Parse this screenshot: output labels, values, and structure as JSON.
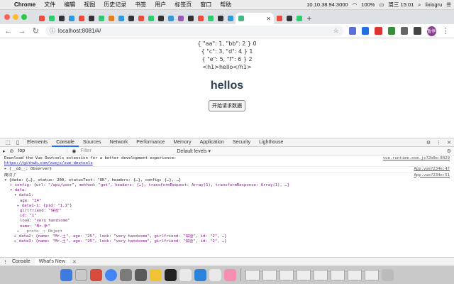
{
  "menubar": {
    "app_name": "Chrome",
    "items": [
      "文件",
      "编辑",
      "视图",
      "历史记录",
      "书签",
      "用户",
      "标签页",
      "窗口",
      "帮助"
    ],
    "ip": "10.10.38.94:3000",
    "battery": "100%",
    "clock": "周三 15:01",
    "user": "lixingru"
  },
  "toolbar": {
    "url": "localhost:8081/#/",
    "avatar_text": "暂停"
  },
  "page": {
    "lines": [
      "{ \"aa\": 1, \"bb\": 2 } 0",
      "{ \"c\": 3, \"d\": 4 } 1",
      "{ \"e\": 5, \"f\": 6 } 2",
      "<h1>hello</h1>"
    ],
    "heading": "hellos",
    "button_label": "开始请求数据"
  },
  "devtools": {
    "tabs": [
      "Elements",
      "Console",
      "Sources",
      "Network",
      "Performance",
      "Memory",
      "Application",
      "Security",
      "Lighthouse"
    ],
    "selected_tab": "Console",
    "context": "top",
    "filter_placeholder": "Filter",
    "levels": "Default levels ▾",
    "console": {
      "devtools_msg_1": "Download the Vue Devtools extension for a better development experience:",
      "devtools_msg_2": "https://github.com/vuejs/vue-devtools",
      "src_1": "vue.runtime.esm.js?2b0e:8429",
      "observer": "▸ {__ob__: Observer}",
      "src_2": "App.vue?234e:47",
      "success": "成功了",
      "src_3": "App.vue?234e:51",
      "response": "▾ {data: {…}, status: 200, statusText: \"OK\", headers: {…}, config: {…}, …}",
      "config_line": "▸ config: {url: \"/api/user\", method: \"get\", headers: {…}, transformRequest: Array(1), transformResponse: Array(1), …}",
      "data_open": "▾ data:",
      "data1_open": "▾ data1:",
      "age": "age: \"24\"",
      "data1_1": "▸ data1-1: {pid: \"1.1\"}",
      "girlfriend": "girlfriend: \"保密\"",
      "id": "id: \"1\"",
      "look": "look: \"very handsome\"",
      "name": "name: \"Mr.李\"",
      "proto": "▸ __proto__: Object",
      "data2": "▸ data2: {name: \"Mr.王\", age: \"25\", look: \"very handsome\", girlfriend: \"保密\", id: \"2\", …}",
      "data3": "▸ data3: {name: \"Mr.王\", age: \"25\", look: \"very handsome\", girlfriend: \"保密\", id: \"2\", …}"
    }
  },
  "drawer": {
    "tabs": [
      "Console",
      "What's New"
    ]
  }
}
